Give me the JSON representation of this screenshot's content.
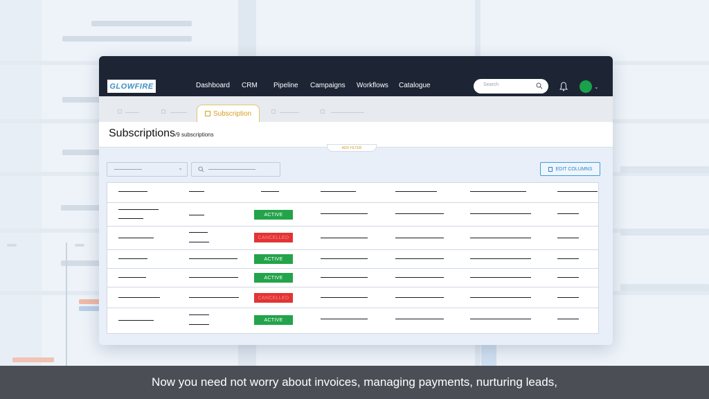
{
  "colors": {
    "navbar": "#1d2535",
    "accent_tab": "#d89b1d",
    "status_active": "#23a34a",
    "status_cancelled": "#e23434",
    "edit_columns": "#2e86c8",
    "caption_bg": "#4b4f55"
  },
  "app": {
    "logo_text": "GLOWFIRE",
    "nav": [
      "Dashboard",
      "CRM",
      "Pipeline",
      "Campaigns",
      "Workflows",
      "Catalogue"
    ],
    "search_placeholder": "Search",
    "icons": [
      "search-icon",
      "bell-icon",
      "avatar",
      "chevron-down-icon"
    ]
  },
  "tabs": {
    "active_label": "Subscription"
  },
  "page": {
    "title": "Subscriptions",
    "subtitle": "/9 subscriptions",
    "add_filter": "ADD FILTER",
    "edit_columns": "EDIT COLUMNS"
  },
  "table": {
    "statuses": [
      "ACTIVE",
      "CANCELLED",
      "ACTIVE",
      "ACTIVE",
      "CANCELLED",
      "ACTIVE"
    ]
  },
  "caption": "Now you need not worry about invoices, managing payments, nurturing leads,"
}
